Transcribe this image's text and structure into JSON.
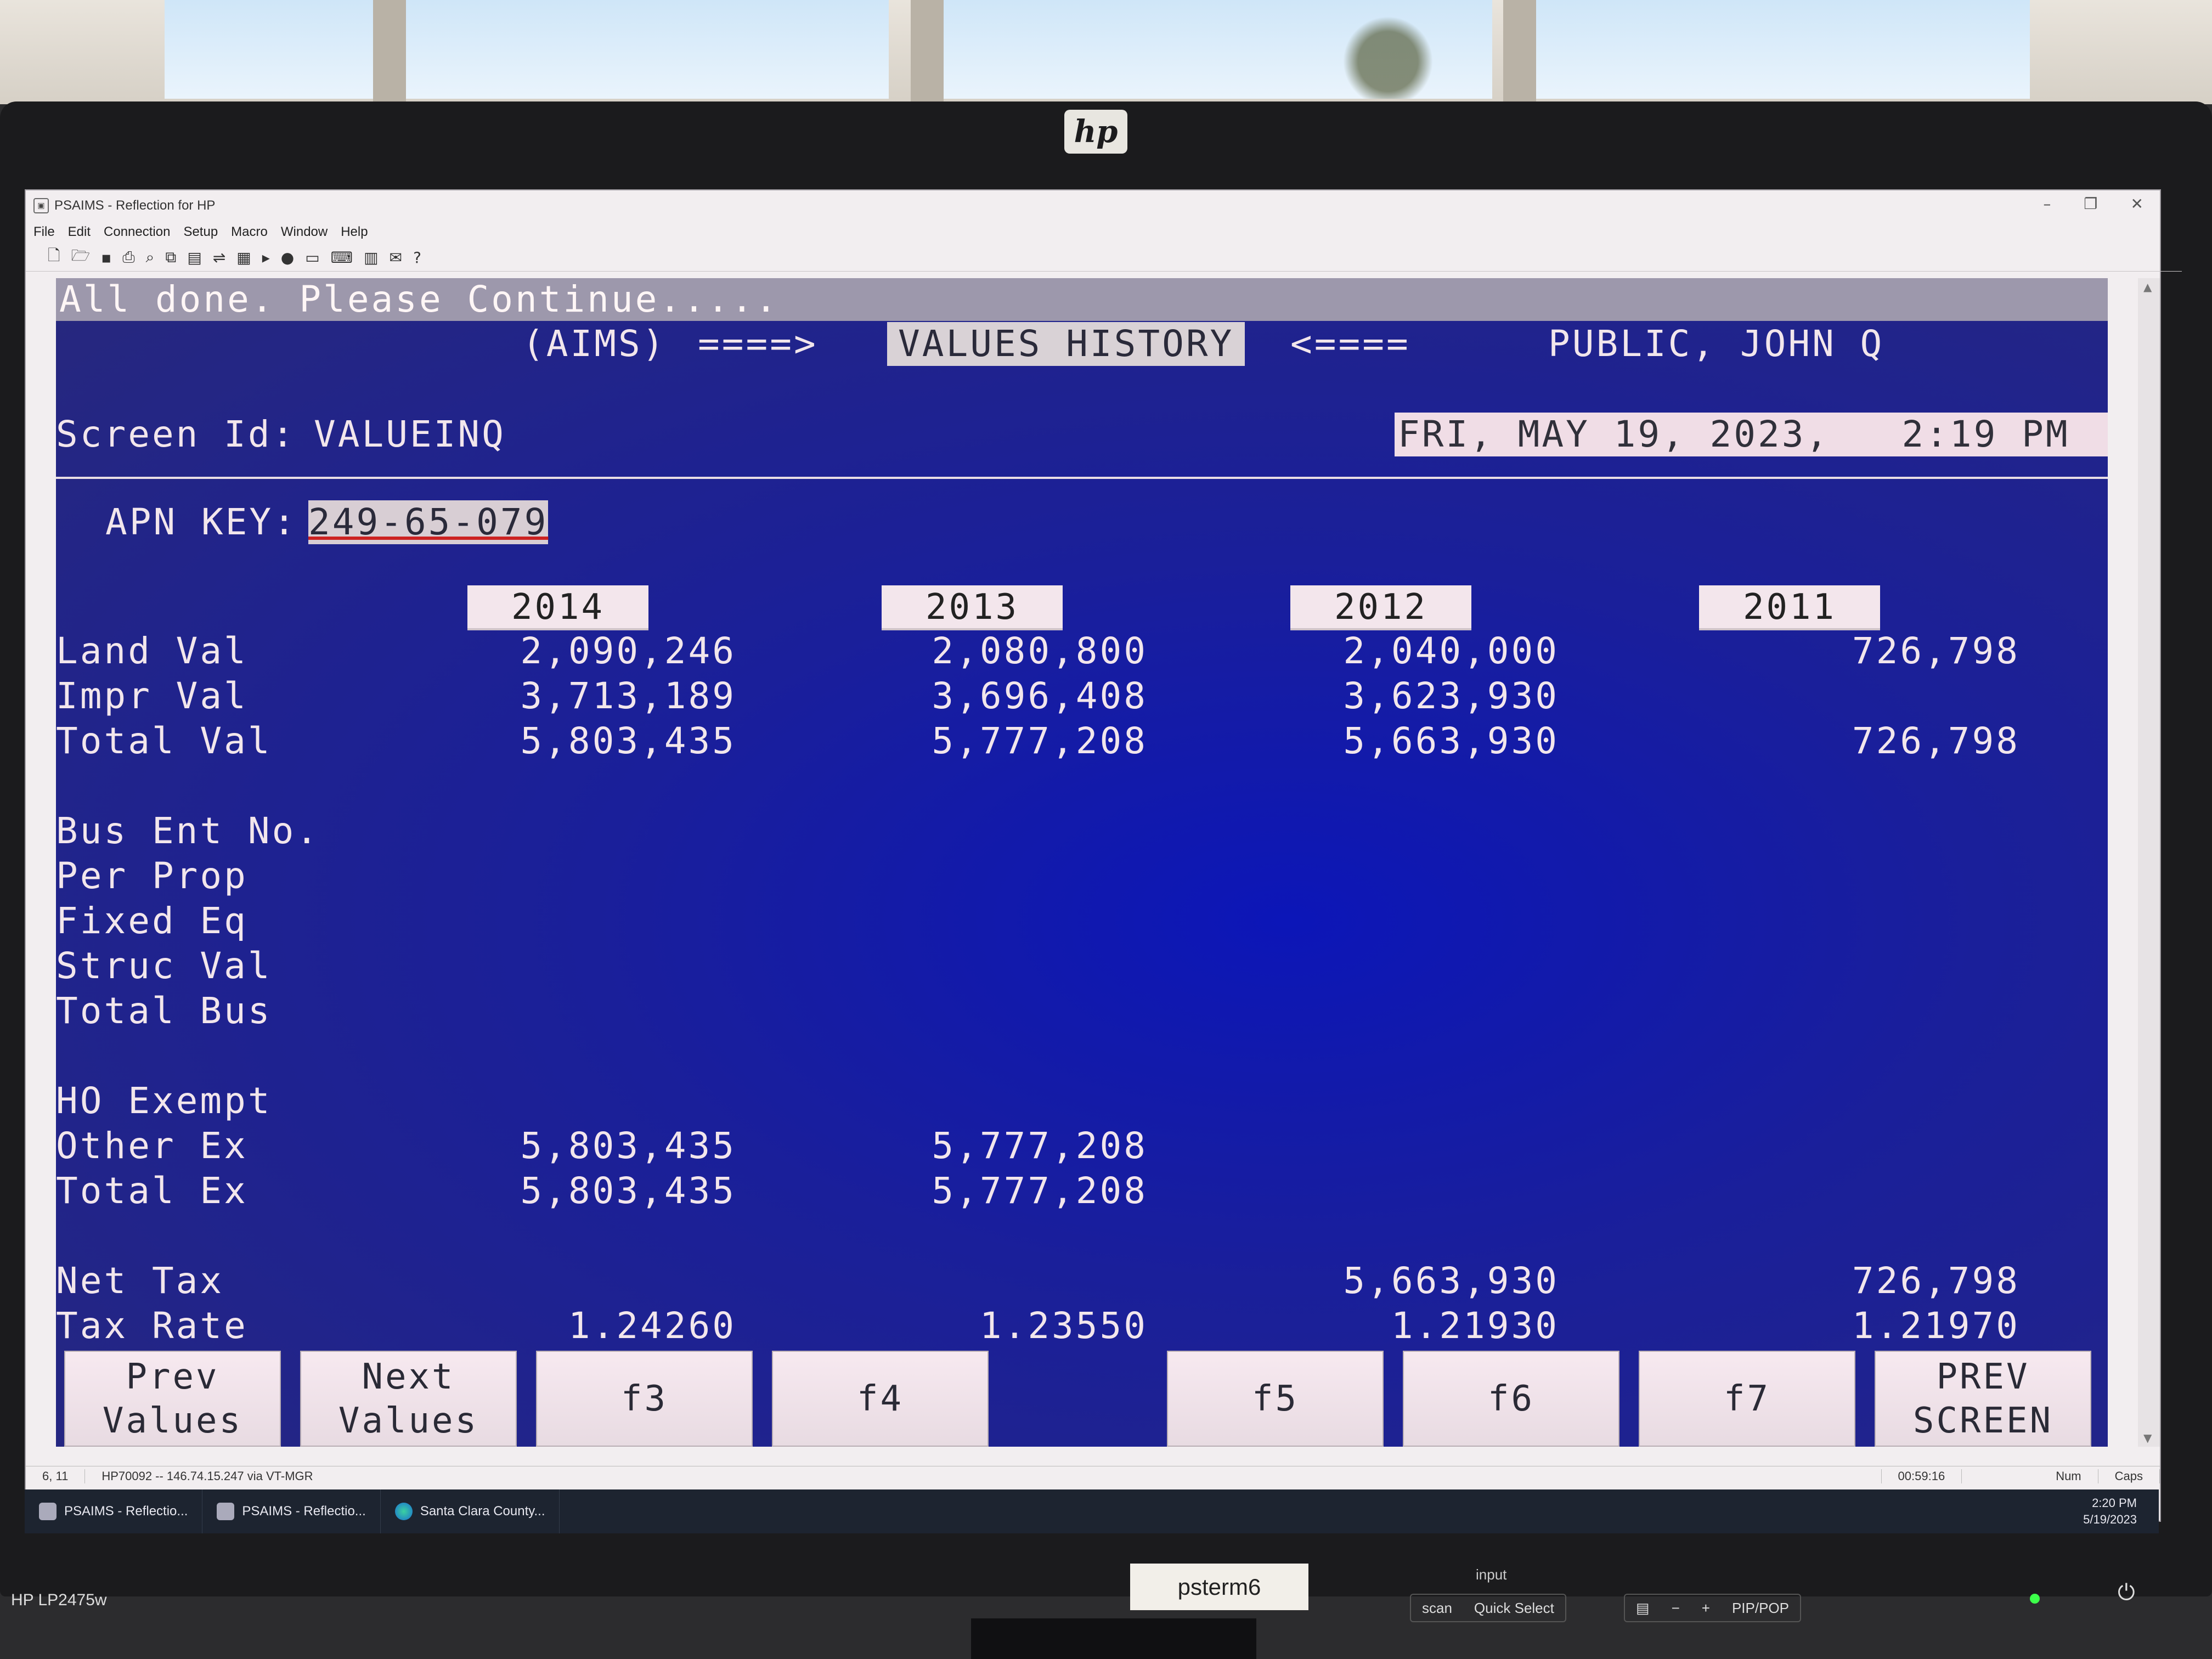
{
  "window": {
    "title": "PSAIMS - Reflection for HP",
    "menu": [
      "File",
      "Edit",
      "Connection",
      "Setup",
      "Macro",
      "Window",
      "Help"
    ]
  },
  "terminal": {
    "status_message": "All done.  Please Continue.....",
    "system_label": "(AIMS)",
    "arrow_right": "====>",
    "screen_title": "VALUES HISTORY",
    "arrow_left": "<====",
    "user_name": "PUBLIC, JOHN Q",
    "screen_id_label": "Screen Id:",
    "screen_id": "VALUEINQ",
    "datetime": "FRI, MAY 19, 2023,   2:19 PM",
    "apn_label": "APN KEY:",
    "apn_value": "249-65-079",
    "years": [
      "2014",
      "2013",
      "2012",
      "2011"
    ],
    "rows": {
      "land_val": {
        "label": "Land Val",
        "values": [
          "2,090,246",
          "2,080,800",
          "2,040,000",
          "726,798"
        ]
      },
      "impr_val": {
        "label": "Impr Val",
        "values": [
          "3,713,189",
          "3,696,408",
          "3,623,930",
          ""
        ]
      },
      "total_val": {
        "label": "Total Val",
        "values": [
          "5,803,435",
          "5,777,208",
          "5,663,930",
          "726,798"
        ]
      },
      "bus_ent_no": {
        "label": "Bus Ent No."
      },
      "per_prop": {
        "label": "Per Prop"
      },
      "fixed_eq": {
        "label": "Fixed Eq"
      },
      "struc_val": {
        "label": "Struc Val"
      },
      "total_bus": {
        "label": "Total Bus"
      },
      "ho_exempt": {
        "label": "HO Exempt"
      },
      "other_ex": {
        "label": "Other Ex",
        "values": [
          "5,803,435",
          "5,777,208",
          "",
          ""
        ]
      },
      "total_ex": {
        "label": "Total Ex",
        "values": [
          "5,803,435",
          "5,777,208",
          "",
          ""
        ]
      },
      "net_tax": {
        "label": "Net Tax",
        "values": [
          "",
          "",
          "5,663,930",
          "726,798"
        ]
      },
      "tax_rate": {
        "label": "Tax Rate",
        "values": [
          "1.24260",
          "1.23550",
          "1.21930",
          "1.21970"
        ]
      }
    },
    "function_keys": [
      {
        "line1": "Prev",
        "line2": "Values"
      },
      {
        "line1": "Next",
        "line2": "Values"
      },
      {
        "line1": "f3",
        "line2": ""
      },
      {
        "line1": "f4",
        "line2": ""
      },
      {
        "line1": "f5",
        "line2": ""
      },
      {
        "line1": "f6",
        "line2": ""
      },
      {
        "line1": "f7",
        "line2": ""
      },
      {
        "line1": "PREV",
        "line2": "SCREEN"
      }
    ]
  },
  "statusbar": {
    "cursor_pos": "6, 11",
    "connection": "HP70092 -- 146.74.15.247 via VT-MGR",
    "timer": "00:59:16",
    "num": "Num",
    "caps": "Caps"
  },
  "taskbar": {
    "items": [
      "PSAIMS - Reflectio...",
      "PSAIMS - Reflectio...",
      "Santa Clara County..."
    ],
    "time": "2:20 PM",
    "date": "5/19/2023"
  },
  "monitor": {
    "brand_logo": "hp",
    "model": "HP LP2475w",
    "label_tag": "psterm6",
    "osd_title": "input",
    "osd_buttons": [
      "scan",
      "Quick Select",
      "PIP/POP"
    ]
  },
  "colors": {
    "terminal_bg": "#1a1f9a",
    "terminal_text": "#f2e6ec",
    "key_bg": "#f7e9f0"
  }
}
